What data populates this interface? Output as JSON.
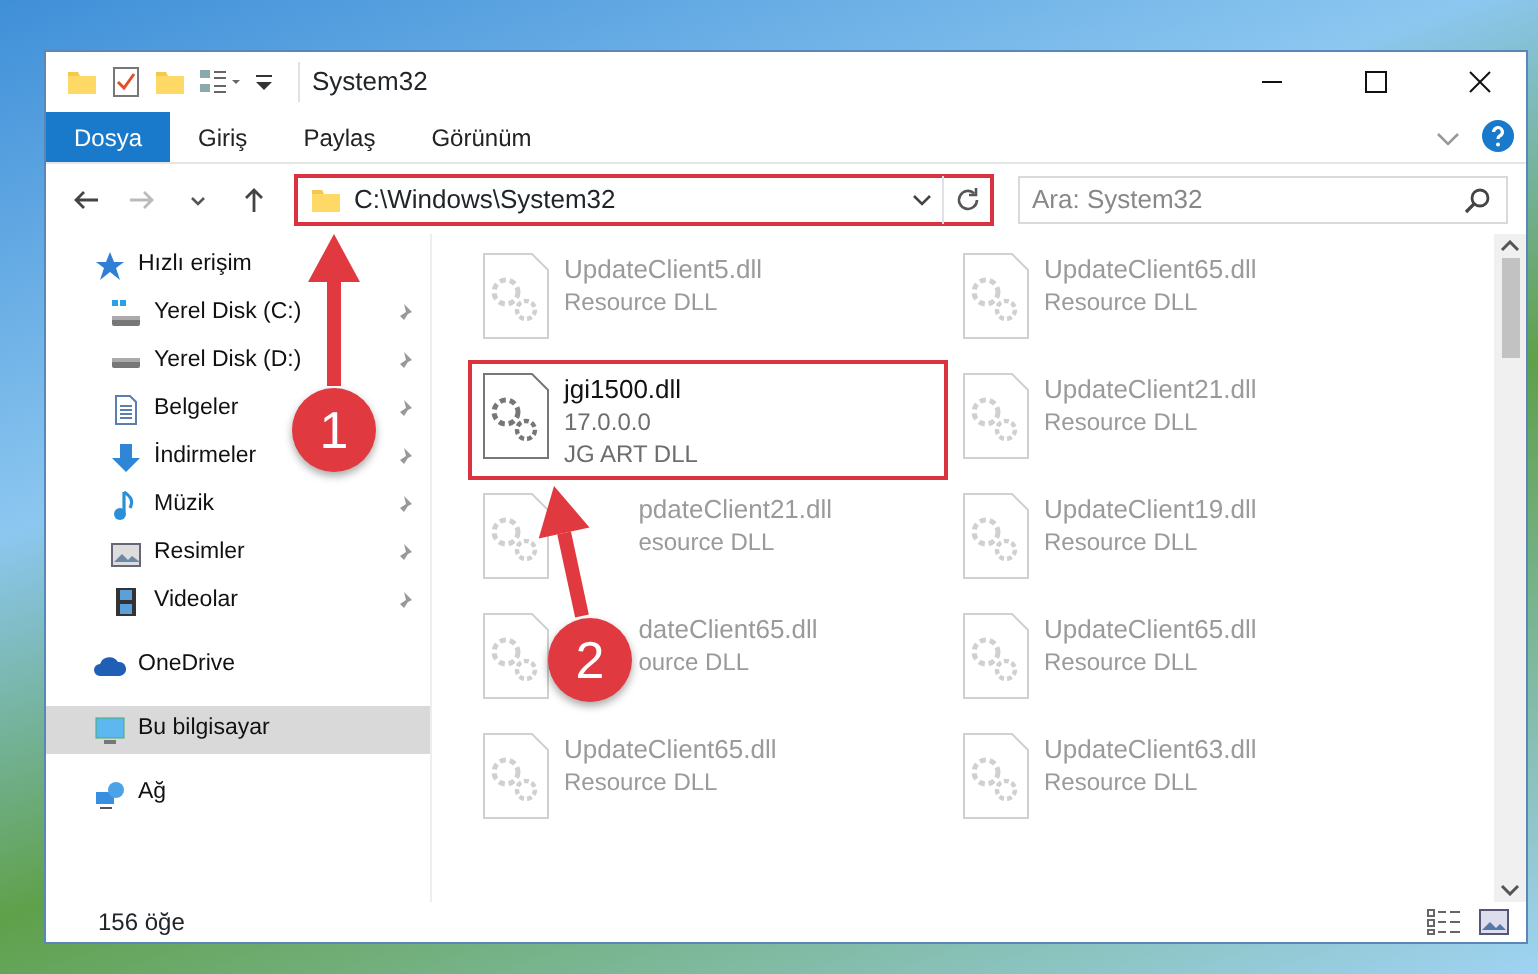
{
  "window": {
    "title": "System32",
    "controls": [
      {
        "kind": "minimize"
      },
      {
        "kind": "maximize"
      },
      {
        "kind": "close"
      }
    ]
  },
  "ribbon_tabs": [
    {
      "label": "Dosya",
      "selected": true
    },
    {
      "label": "Giriş",
      "selected": false
    },
    {
      "label": "Paylaş",
      "selected": false
    },
    {
      "label": "Görünüm",
      "selected": false
    }
  ],
  "address_bar": {
    "path": "C:\\Windows\\System32",
    "highlighted": true
  },
  "search": {
    "placeholder": "Ara: System32"
  },
  "sidebar": {
    "items": [
      {
        "label": "Hızlı erişim",
        "kind": "star",
        "selected": false,
        "children": [
          {
            "label": "Yerel Disk (C:)",
            "kind": "system-drive",
            "pinned": true,
            "selected": false
          },
          {
            "label": "Yerel Disk (D:)",
            "kind": "drive",
            "pinned": true,
            "selected": false
          },
          {
            "label": "Belgeler",
            "kind": "documents",
            "pinned": true,
            "selected": false
          },
          {
            "label": "İndirmeler",
            "kind": "downloads",
            "pinned": true,
            "selected": false
          },
          {
            "label": "Müzik",
            "kind": "music",
            "pinned": true,
            "selected": false
          },
          {
            "label": "Resimler",
            "kind": "pictures",
            "pinned": true,
            "selected": false
          },
          {
            "label": "Videolar",
            "kind": "videos",
            "pinned": true,
            "selected": false
          }
        ]
      },
      {
        "label": "OneDrive",
        "kind": "cloud",
        "selected": false
      },
      {
        "label": "Bu bilgisayar",
        "kind": "computer",
        "selected": true
      },
      {
        "label": "Ağ",
        "kind": "network",
        "selected": false
      }
    ]
  },
  "files": [
    {
      "name": "UpdateClient5.dll",
      "detail": [
        "Resource DLL"
      ],
      "blurred": true,
      "highlighted": false
    },
    {
      "name": "UpdateClient65.dll",
      "detail": [
        "Resource DLL"
      ],
      "blurred": true,
      "highlighted": false
    },
    {
      "name": "jgi1500.dll",
      "detail": [
        "17.0.0.0",
        "JG ART DLL"
      ],
      "blurred": false,
      "highlighted": true
    },
    {
      "name": "UpdateClient21.dll",
      "detail": [
        "Resource DLL"
      ],
      "blurred": true,
      "highlighted": false
    },
    {
      "name": "pdateClient21.dll",
      "detail": [
        "esource DLL"
      ],
      "blurred": true,
      "highlighted": false,
      "covered": true
    },
    {
      "name": "UpdateClient19.dll",
      "detail": [
        "Resource DLL"
      ],
      "blurred": true,
      "highlighted": false
    },
    {
      "name": "dateClient65.dll",
      "detail": [
        "ource DLL"
      ],
      "blurred": true,
      "highlighted": false,
      "covered": true
    },
    {
      "name": "UpdateClient65.dll",
      "detail": [
        "Resource DLL"
      ],
      "blurred": true,
      "highlighted": false
    },
    {
      "name": "UpdateClient65.dll",
      "detail": [
        "Resource DLL"
      ],
      "blurred": true,
      "highlighted": false
    },
    {
      "name": "UpdateClient63.dll",
      "detail": [
        "Resource DLL"
      ],
      "blurred": true,
      "highlighted": false
    }
  ],
  "status_bar": {
    "count": "156 öğe"
  },
  "annotations": [
    {
      "label": "1"
    },
    {
      "label": "2"
    }
  ]
}
